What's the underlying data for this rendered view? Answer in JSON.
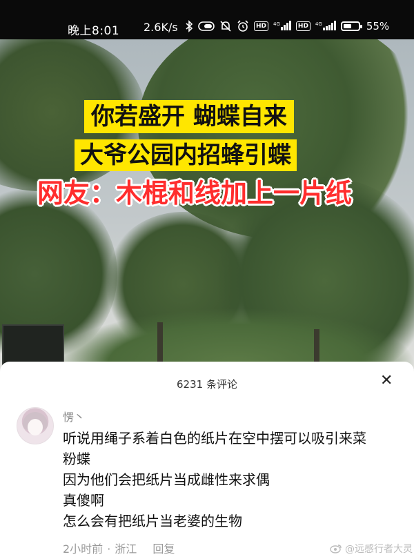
{
  "status_bar": {
    "time": "晚上8:01",
    "network_speed": "2.6K/s",
    "icons": [
      "bluetooth-icon",
      "toggle-icon",
      "mute-icon",
      "alarm-icon",
      "hd-icon",
      "signal-4g-icon",
      "hd-icon",
      "signal-4g-icon",
      "battery-icon"
    ],
    "sim1_label": "HD",
    "sim1_network": "4G",
    "sim2_label": "HD",
    "sim2_network": "4G",
    "battery_level": 0.55,
    "battery_percent": "55%"
  },
  "video": {
    "caption_line1": "你若盛开 蝴蝶自来",
    "caption_line2": "大爷公园内招蜂引蝶",
    "caption_line3": "网友：木棍和线加上一片纸",
    "colors": {
      "caption_bg": "#ffe600",
      "caption_red": "#ff2d2d"
    }
  },
  "comments_panel": {
    "count_label": "6231 条评论",
    "close_icon": "close-icon",
    "comment": {
      "username": "愣丶",
      "lines": [
        "听说用绳子系着白色的纸片在空中摆可以吸引来菜",
        "粉蝶",
        "因为他们会把纸片当成雌性来求偶",
        "真傻啊",
        "怎么会有把纸片当老婆的生物"
      ],
      "time": "2小时前",
      "location": "浙江",
      "reply_label": "回复"
    },
    "watermark": "@远感行者大灵"
  }
}
